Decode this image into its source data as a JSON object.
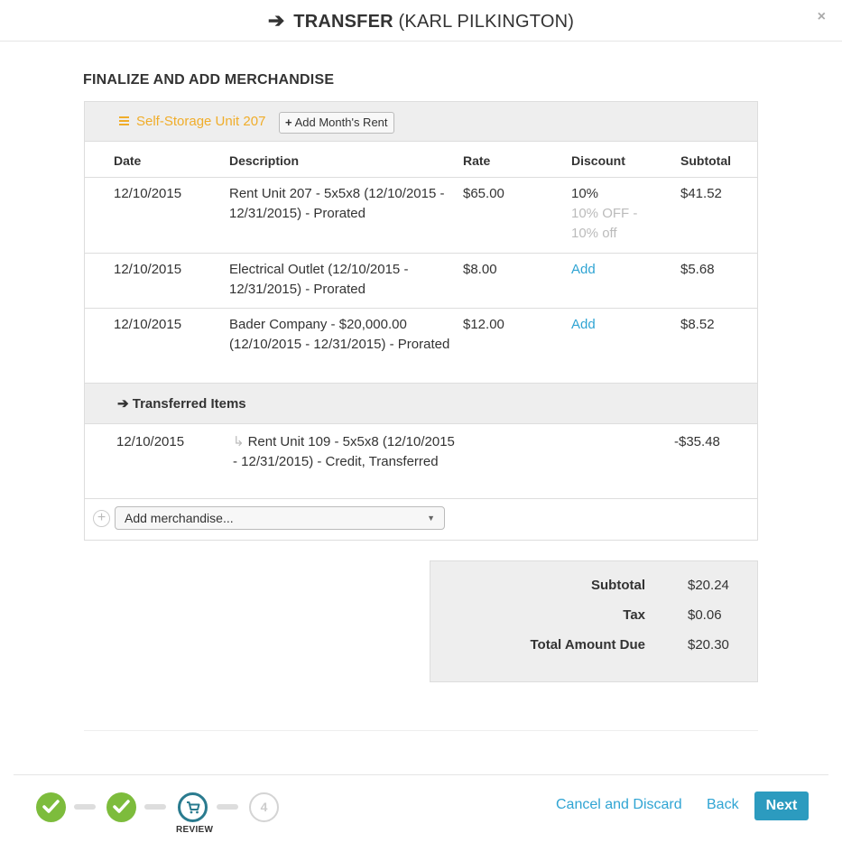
{
  "header": {
    "arrow": "➔",
    "title": "TRANSFER",
    "subtitle": "(KARL PILKINGTON)",
    "close": "×"
  },
  "section_title": "FINALIZE AND ADD MERCHANDISE",
  "unit": {
    "name": "Self-Storage Unit 207",
    "add_rent_label": "Add Month's Rent"
  },
  "columns": {
    "date": "Date",
    "description": "Description",
    "rate": "Rate",
    "discount": "Discount",
    "subtotal": "Subtotal"
  },
  "rows": [
    {
      "date": "12/10/2015",
      "description": "Rent Unit 207 - 5x5x8 (12/10/2015 - 12/31/2015) - Prorated",
      "rate": "$65.00",
      "discount": "10%",
      "discount_note": "10% OFF - 10% off",
      "subtotal": "$41.52"
    },
    {
      "date": "12/10/2015",
      "description": "Electrical Outlet (12/10/2015 - 12/31/2015) - Prorated",
      "rate": "$8.00",
      "discount": "Add",
      "subtotal": "$5.68"
    },
    {
      "date": "12/10/2015",
      "description": "Bader Company - $20,000.00 (12/10/2015 - 12/31/2015) - Prorated",
      "rate": "$12.00",
      "discount": "Add",
      "subtotal": "$8.52"
    }
  ],
  "transferred": {
    "label": "➔ Transferred Items",
    "items": [
      {
        "hook": "↳",
        "date": "12/10/2015",
        "description": "Rent Unit 109 - 5x5x8 (12/10/2015 - 12/31/2015) - Credit, Transferred",
        "subtotal": "-$35.48"
      }
    ]
  },
  "merchandise": {
    "plus": "+",
    "placeholder": "Add merchandise...",
    "caret": "▼"
  },
  "totals": {
    "subtotal_label": "Subtotal",
    "subtotal": "$20.24",
    "tax_label": "Tax",
    "tax": "$0.06",
    "total_label": "Total Amount Due",
    "total": "$20.30"
  },
  "steps": {
    "step4": "4",
    "current_label": "REVIEW"
  },
  "footer": {
    "cancel_label": "Cancel and Discard",
    "back_label": "Back",
    "next_label": "Next"
  },
  "icons": {
    "close": "close-icon",
    "arrow": "arrow-right-icon",
    "unit": "storage-unit-icon",
    "check": "check-icon",
    "cart": "shopping-cart-icon"
  },
  "colors": {
    "accent": "#2fa4d3",
    "primary_button": "#2c9bbf",
    "unit_name": "#f0ad2a",
    "step_done": "#7dbc3c",
    "step_current": "#2a7b8f"
  }
}
